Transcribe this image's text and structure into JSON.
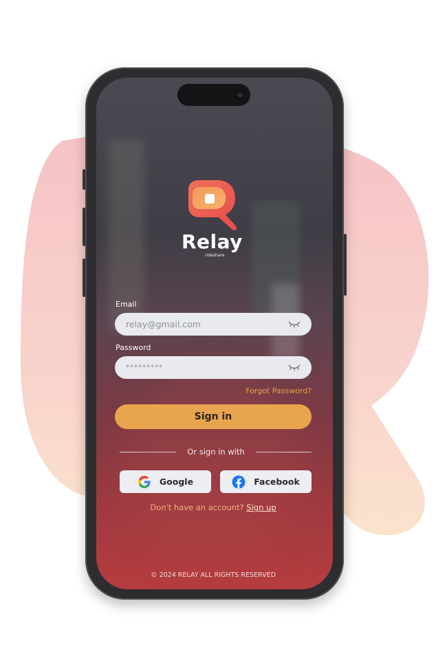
{
  "brand": {
    "name": "Relay",
    "tagline": "rideshare",
    "colors": {
      "accent": "#e8a54e",
      "logo_start": "#f0715a",
      "logo_end": "#f7b36a",
      "blob": "#f4c4c6"
    }
  },
  "login": {
    "email_label": "Email",
    "email_value": "relay@gmail.com",
    "password_label": "Password",
    "password_value": "*********",
    "forgot_label": "Forgot Password?",
    "signin_label": "Sign in"
  },
  "social": {
    "divider_text": "Or sign in with",
    "google_label": "Google",
    "facebook_label": "Facebook"
  },
  "signup": {
    "prompt": "Don't have an account?",
    "link": "Sign up"
  },
  "footer": {
    "text": "© 2024 RELAY ALL RIGHTS RESERVED"
  },
  "icons": {
    "email_toggle": "eye-closed-icon",
    "password_toggle": "eye-closed-icon",
    "google": "google-icon",
    "facebook": "facebook-icon"
  }
}
